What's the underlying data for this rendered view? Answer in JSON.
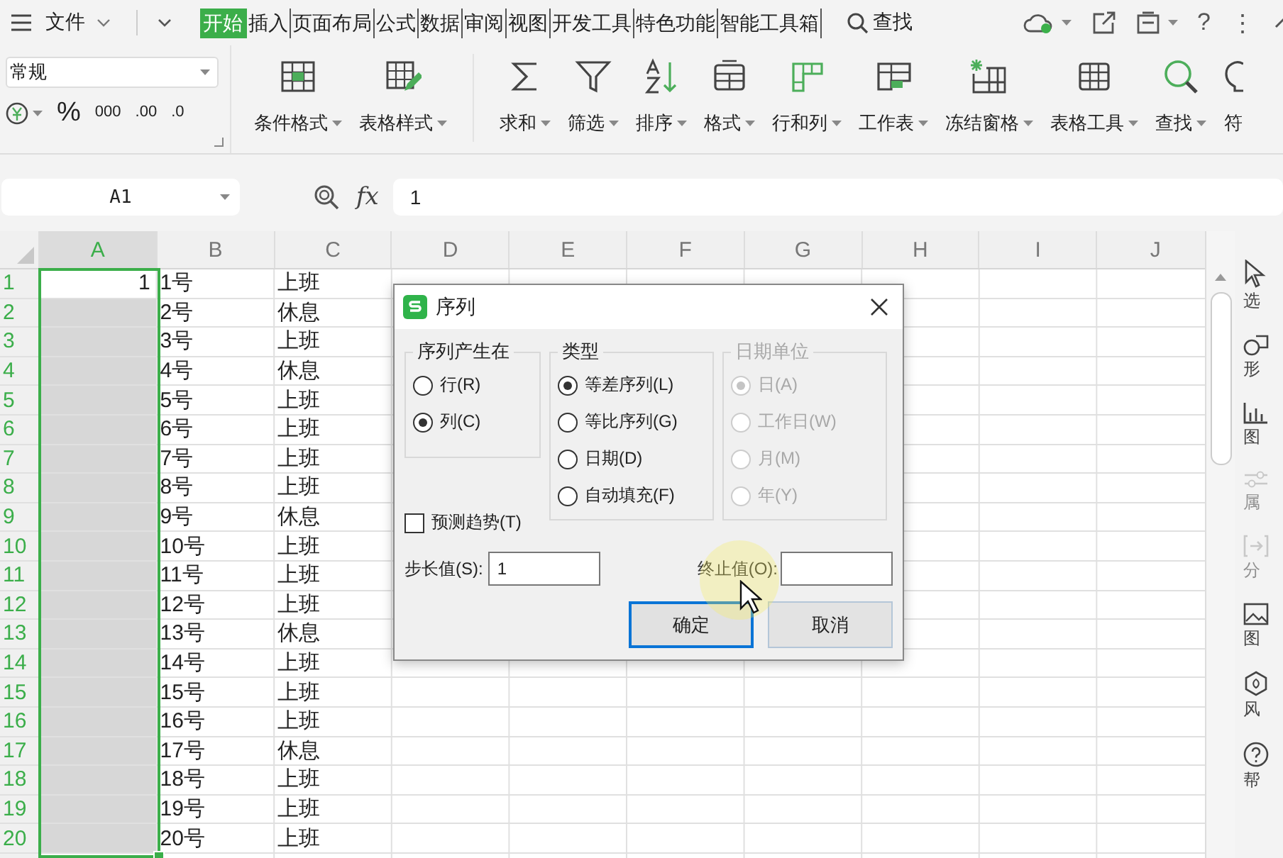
{
  "menu_bar": {
    "file_menu": "文件",
    "tabs": [
      {
        "label": "开始",
        "selected": true
      },
      {
        "label": "插入",
        "selected": false
      },
      {
        "label": "页面布局",
        "selected": false
      },
      {
        "label": "公式",
        "selected": false
      },
      {
        "label": "数据",
        "selected": false
      },
      {
        "label": "审阅",
        "selected": false
      },
      {
        "label": "视图",
        "selected": false
      },
      {
        "label": "开发工具",
        "selected": false
      },
      {
        "label": "特色功能",
        "selected": false
      },
      {
        "label": "智能工具箱",
        "selected": false
      }
    ],
    "search": "查找",
    "right_icons": [
      {
        "kind": "cloud"
      },
      {
        "kind": "share"
      },
      {
        "kind": "box"
      },
      {
        "kind": "text",
        "label": "?"
      },
      {
        "kind": "text",
        "label": "⋮"
      },
      {
        "kind": "chevron"
      }
    ]
  },
  "ribbon": {
    "number_format": "常规",
    "format_buttons": [
      {
        "kind": "currency"
      },
      {
        "kind": "text",
        "label": "%"
      },
      {
        "kind": "text",
        "label": "000"
      },
      {
        "kind": "text",
        "label": ".00"
      },
      {
        "kind": "text",
        "label": ".0"
      }
    ],
    "tools": [
      {
        "label": "条件格式",
        "kind": "conditional",
        "dropdown": true
      },
      {
        "label": "表格样式",
        "kind": "tablestyle",
        "dropdown": true
      },
      {
        "label": "求和",
        "kind": "sum",
        "dropdown": true
      },
      {
        "label": "筛选",
        "kind": "filter",
        "dropdown": true
      },
      {
        "label": "排序",
        "kind": "sort",
        "dropdown": true
      },
      {
        "label": "格式",
        "kind": "format",
        "dropdown": true
      },
      {
        "label": "行和列",
        "kind": "rowcol",
        "dropdown": true
      },
      {
        "label": "工作表",
        "kind": "sheet",
        "dropdown": true
      },
      {
        "label": "冻结窗格",
        "kind": "freeze",
        "dropdown": true
      },
      {
        "label": "表格工具",
        "kind": "tabletools",
        "dropdown": true
      },
      {
        "label": "查找",
        "kind": "find",
        "dropdown": true
      },
      {
        "label": "符",
        "kind": "symbol",
        "dropdown": false
      }
    ]
  },
  "formula_bar": {
    "name_box": "A1",
    "fx": "fx",
    "value": "1"
  },
  "sheet": {
    "columns": [
      {
        "label": "A",
        "selected": true
      },
      {
        "label": "B",
        "selected": false
      },
      {
        "label": "C",
        "selected": false
      },
      {
        "label": "D",
        "selected": false
      },
      {
        "label": "E",
        "selected": false
      },
      {
        "label": "F",
        "selected": false
      },
      {
        "label": "G",
        "selected": false
      },
      {
        "label": "H",
        "selected": false
      },
      {
        "label": "I",
        "selected": false
      },
      {
        "label": "J",
        "selected": false
      }
    ],
    "rows": [
      {
        "number": "1",
        "selected": true,
        "active": true,
        "a": "1",
        "b": "1号",
        "c": "上班"
      },
      {
        "number": "2",
        "selected": true,
        "active": false,
        "b": "2号",
        "c": "休息"
      },
      {
        "number": "3",
        "selected": true,
        "active": false,
        "b": "3号",
        "c": "上班"
      },
      {
        "number": "4",
        "selected": true,
        "active": false,
        "b": "4号",
        "c": "休息"
      },
      {
        "number": "5",
        "selected": true,
        "active": false,
        "b": "5号",
        "c": "上班"
      },
      {
        "number": "6",
        "selected": true,
        "active": false,
        "b": "6号",
        "c": "上班"
      },
      {
        "number": "7",
        "selected": true,
        "active": false,
        "b": "7号",
        "c": "上班"
      },
      {
        "number": "8",
        "selected": true,
        "active": false,
        "b": "8号",
        "c": "上班"
      },
      {
        "number": "9",
        "selected": true,
        "active": false,
        "b": "9号",
        "c": "休息"
      },
      {
        "number": "10",
        "selected": true,
        "active": false,
        "b": "10号",
        "c": "上班"
      },
      {
        "number": "11",
        "selected": true,
        "active": false,
        "b": "11号",
        "c": "上班"
      },
      {
        "number": "12",
        "selected": true,
        "active": false,
        "b": "12号",
        "c": "上班"
      },
      {
        "number": "13",
        "selected": true,
        "active": false,
        "b": "13号",
        "c": "休息"
      },
      {
        "number": "14",
        "selected": true,
        "active": false,
        "b": "14号",
        "c": "上班"
      },
      {
        "number": "15",
        "selected": true,
        "active": false,
        "b": "15号",
        "c": "上班"
      },
      {
        "number": "16",
        "selected": true,
        "active": false,
        "b": "16号",
        "c": "上班"
      },
      {
        "number": "17",
        "selected": true,
        "active": false,
        "b": "17号",
        "c": "休息"
      },
      {
        "number": "18",
        "selected": true,
        "active": false,
        "b": "18号",
        "c": "上班"
      },
      {
        "number": "19",
        "selected": true,
        "active": false,
        "b": "19号",
        "c": "上班"
      },
      {
        "number": "20",
        "selected": true,
        "active": false,
        "b": "20号",
        "c": "上班"
      }
    ]
  },
  "side_panel": [
    {
      "label": "选",
      "kind": "select",
      "disabled": false
    },
    {
      "label": "形",
      "kind": "shape",
      "disabled": false
    },
    {
      "label": "图",
      "kind": "chart",
      "disabled": false
    },
    {
      "label": "属",
      "kind": "props",
      "disabled": true
    },
    {
      "label": "分",
      "kind": "analyze",
      "disabled": true
    },
    {
      "label": "图",
      "kind": "image",
      "disabled": false
    },
    {
      "label": "风",
      "kind": "style",
      "disabled": false
    },
    {
      "label": "帮",
      "kind": "help",
      "disabled": false
    }
  ],
  "dialog": {
    "title": "序列",
    "groups": [
      {
        "title": "序列产生在",
        "disabled": false,
        "options": [
          {
            "label": "行(R)",
            "selected": false
          },
          {
            "label": "列(C)",
            "selected": true
          }
        ]
      },
      {
        "title": "类型",
        "disabled": false,
        "options": [
          {
            "label": "等差序列(L)",
            "selected": true
          },
          {
            "label": "等比序列(G)",
            "selected": false
          },
          {
            "label": "日期(D)",
            "selected": false
          },
          {
            "label": "自动填充(F)",
            "selected": false
          }
        ]
      },
      {
        "title": "日期单位",
        "disabled": true,
        "options": [
          {
            "label": "日(A)",
            "selected": true
          },
          {
            "label": "工作日(W)",
            "selected": false
          },
          {
            "label": "月(M)",
            "selected": false
          },
          {
            "label": "年(Y)",
            "selected": false
          }
        ]
      }
    ],
    "trend": {
      "label": "预测趋势(T)",
      "checked": false
    },
    "step": {
      "label": "步长值(S):",
      "value": "1"
    },
    "stop": {
      "label": "终止值(O):"
    },
    "buttons": [
      {
        "label": "确定",
        "default": true
      },
      {
        "label": "取消",
        "default": false
      }
    ]
  }
}
